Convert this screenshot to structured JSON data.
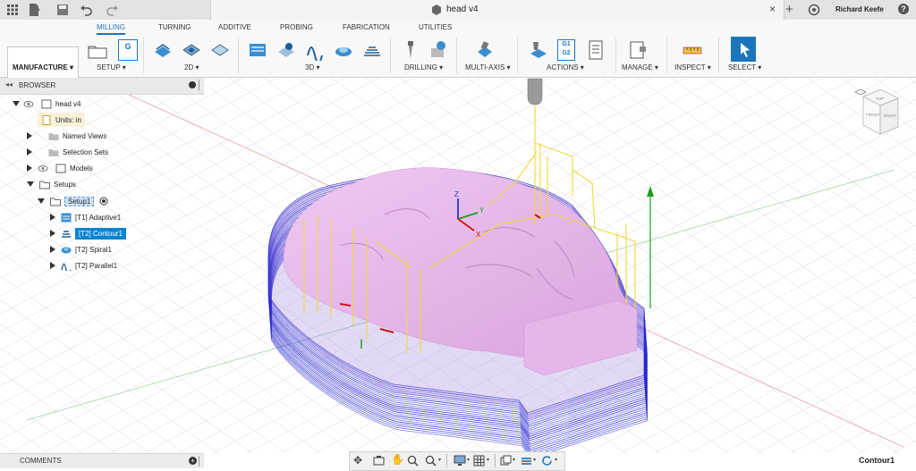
{
  "titlebar": {
    "doc_title": "head v4",
    "user_name": "Richard Keefe",
    "help_label": "?"
  },
  "ribbon": {
    "workspace_label": "MANUFACTURE ▾",
    "tabs": [
      "MILLING",
      "TURNING",
      "ADDITIVE",
      "PROBING",
      "FABRICATION",
      "UTILITIES"
    ],
    "groups": [
      "SETUP ▾",
      "2D ▾",
      "3D ▾",
      "DRILLING ▾",
      "MULTI-AXIS ▾",
      "ACTIONS ▾",
      "MANAGE ▾",
      "INSPECT ▾",
      "SELECT ▾"
    ],
    "actions_g1": "G1",
    "actions_g2": "G2"
  },
  "browser": {
    "title": "BROWSER",
    "root": "head v4",
    "units": "Units: in",
    "named_views": "Named Views",
    "selection_sets": "Selection Sets",
    "models": "Models",
    "setups": "Setups",
    "setup1": "Setup1",
    "ops": [
      "[T1] Adaptive1",
      "[T2] Contour1",
      "[T2] Spiral1",
      "[T2] Parallel1"
    ]
  },
  "viewcube": {
    "top": "TOP",
    "front": "FRONT",
    "right": "RIGHT"
  },
  "triad": {
    "z": "Z",
    "y": "Y",
    "x": "X"
  },
  "comments_label": "COMMENTS",
  "status_text": "Contour1",
  "colors": {
    "accent": "#1b75bc",
    "selected_row": "#0b84d0",
    "model": "#e8b4ec",
    "toolpath": "#2a2ad0",
    "rapid": "#f3e23a"
  }
}
